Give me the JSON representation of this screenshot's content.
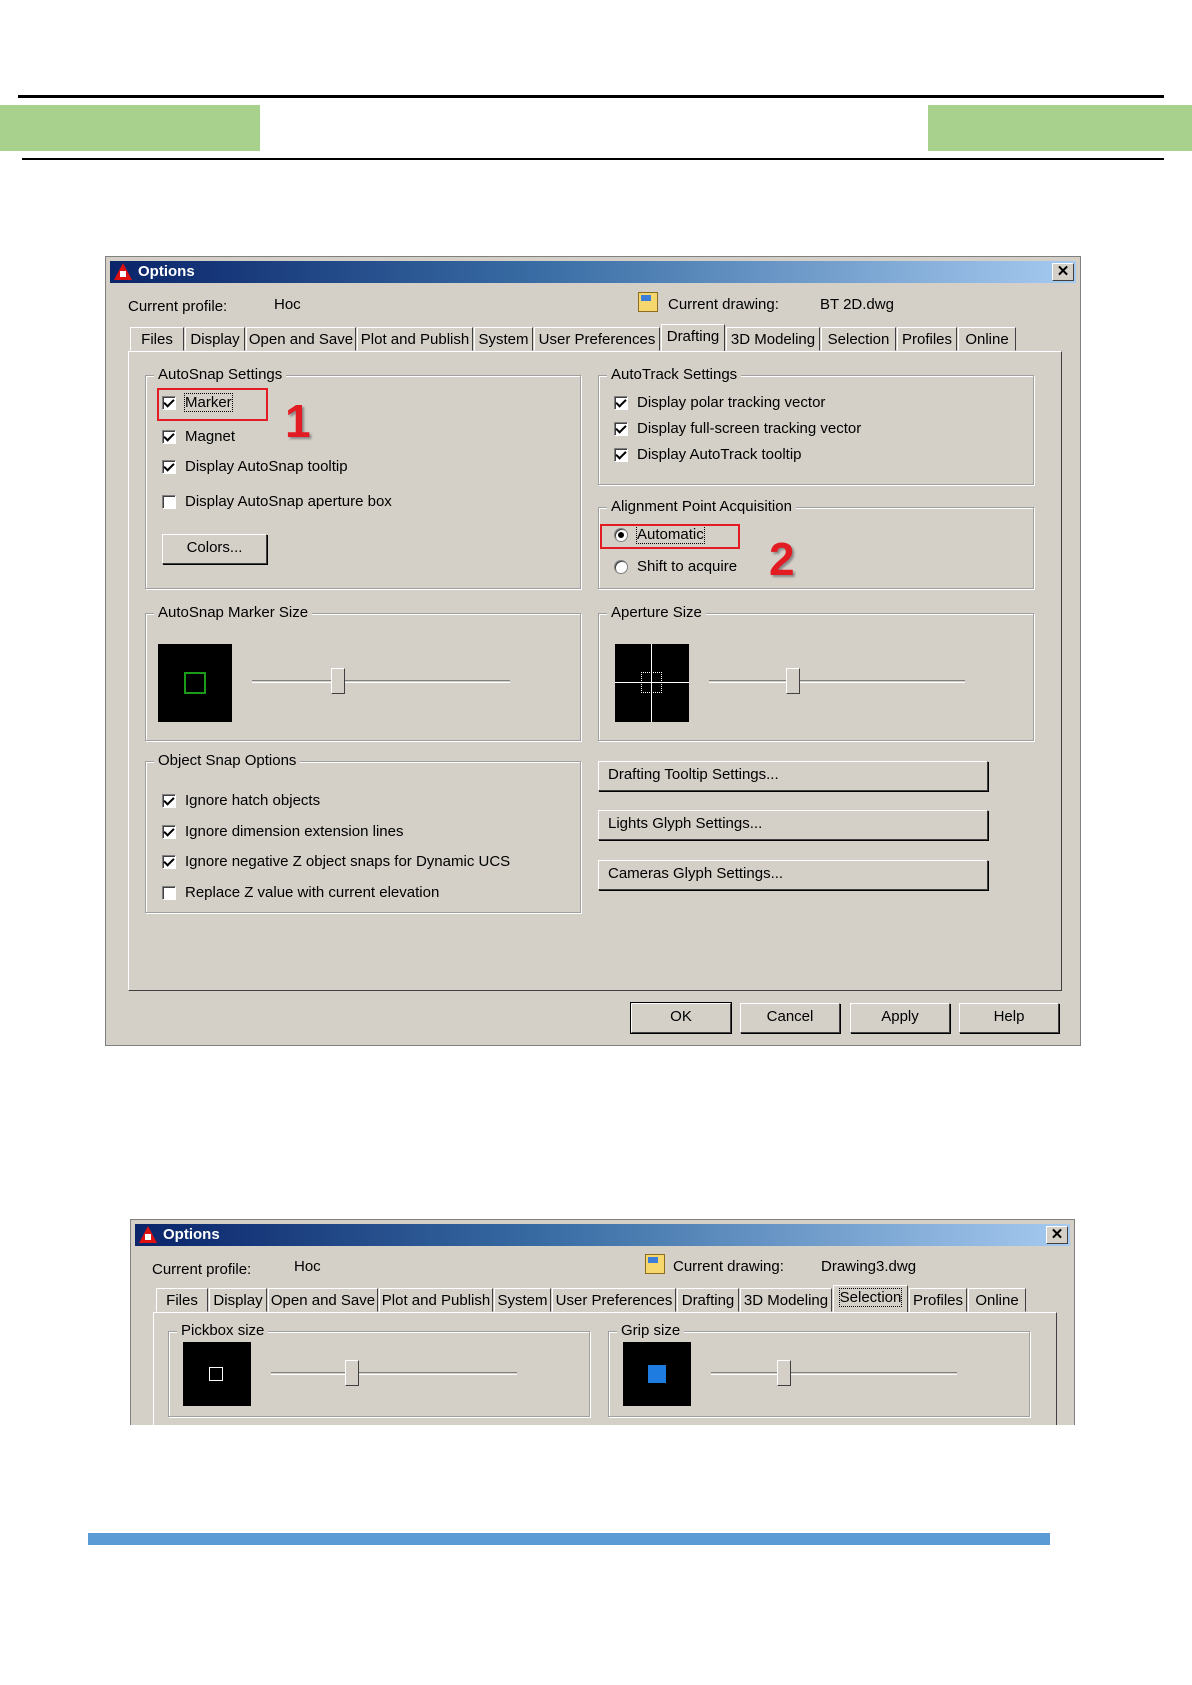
{
  "dialog1": {
    "title": "Options",
    "current_profile_label": "Current profile:",
    "current_profile_value": "Hoc",
    "current_drawing_label": "Current drawing:",
    "current_drawing_value": "BT 2D.dwg",
    "tabs": [
      "Files",
      "Display",
      "Open and Save",
      "Plot and Publish",
      "System",
      "User Preferences",
      "Drafting",
      "3D Modeling",
      "Selection",
      "Profiles",
      "Online"
    ],
    "active_tab": "Drafting",
    "autosnap": {
      "title": "AutoSnap Settings",
      "items": [
        {
          "label": "Marker",
          "checked": true
        },
        {
          "label": "Magnet",
          "checked": true
        },
        {
          "label": "Display AutoSnap tooltip",
          "checked": true
        },
        {
          "label": "Display AutoSnap aperture box",
          "checked": false
        }
      ],
      "colors_button": "Colors..."
    },
    "autotrack": {
      "title": "AutoTrack Settings",
      "items": [
        {
          "label": "Display polar tracking vector",
          "checked": true
        },
        {
          "label": "Display full-screen tracking vector",
          "checked": true
        },
        {
          "label": "Display AutoTrack tooltip",
          "checked": true
        }
      ]
    },
    "alignment": {
      "title": "Alignment Point Acquisition",
      "options": [
        {
          "label": "Automatic",
          "selected": true
        },
        {
          "label": "Shift to acquire",
          "selected": false
        }
      ]
    },
    "marker_size": {
      "title": "AutoSnap Marker Size",
      "slider_fraction": 0.33
    },
    "aperture_size": {
      "title": "Aperture Size",
      "slider_fraction": 0.33
    },
    "object_snap": {
      "title": "Object Snap Options",
      "items": [
        {
          "label": "Ignore hatch objects",
          "checked": true
        },
        {
          "label": "Ignore dimension extension lines",
          "checked": true
        },
        {
          "label": "Ignore negative Z object snaps for Dynamic UCS",
          "checked": true
        },
        {
          "label": "Replace Z value with current elevation",
          "checked": false
        }
      ]
    },
    "side_buttons": [
      "Drafting Tooltip Settings...",
      "Lights Glyph Settings...",
      "Cameras Glyph Settings..."
    ],
    "footer_buttons": [
      "OK",
      "Cancel",
      "Apply",
      "Help"
    ],
    "annotations": [
      "1",
      "2"
    ],
    "colors": {
      "marker_green": "#1a9b1a",
      "highlight_red": "#e31b23"
    }
  },
  "dialog2": {
    "title": "Options",
    "current_profile_label": "Current profile:",
    "current_profile_value": "Hoc",
    "current_drawing_label": "Current drawing:",
    "current_drawing_value": "Drawing3.dwg",
    "tabs": [
      "Files",
      "Display",
      "Open and Save",
      "Plot and Publish",
      "System",
      "User Preferences",
      "Drafting",
      "3D Modeling",
      "Selection",
      "Profiles",
      "Online"
    ],
    "active_tab": "Selection",
    "pickbox": {
      "title": "Pickbox size",
      "slider_fraction": 0.3
    },
    "grip": {
      "title": "Grip size",
      "slider_fraction": 0.3,
      "grip_color": "#1e7be0"
    }
  },
  "page": {
    "green_accent": "#a9d18e",
    "blue_accent": "#5b9bd5"
  }
}
